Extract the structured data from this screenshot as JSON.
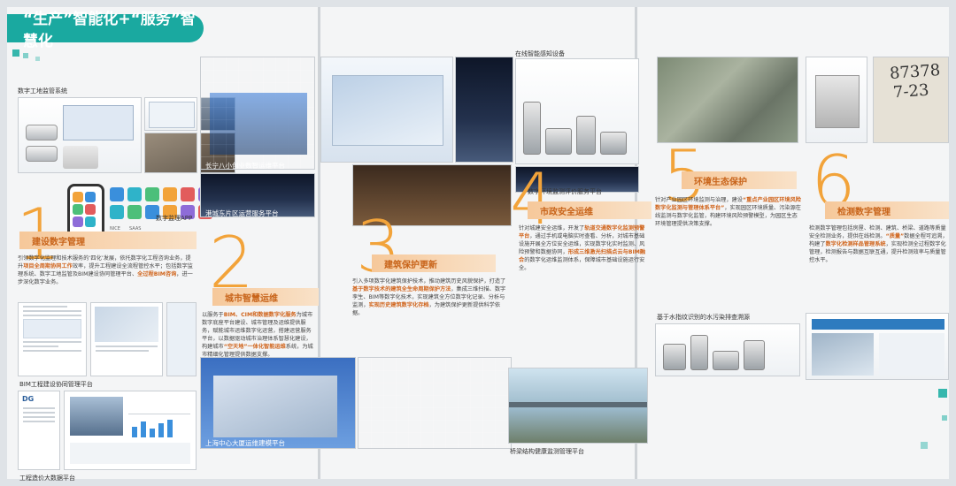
{
  "header": {
    "title": "“生产”智能化+“服务”智慧化"
  },
  "left_page": {
    "top_caption": "数字工地监管系统",
    "phone_caption": "数字监理APP",
    "bim_caption": "BIM工程建设协同管理平台",
    "bigdata_caption": "工程造价大数据平台",
    "section": {
      "number": "1",
      "title": "建设数字管理",
      "text_a": "引领数字化监理和技术服务的‘四化’发展，依托数字化工程咨询业务，提升",
      "hl_a": "项目全周期协同工作",
      "text_b": "效率，提升工程建设全流程管控水平；包括数字监理系统、数字工地监管及BIM建设协同管理平台、",
      "hl_b": "全过程BIM咨询",
      "text_c": "，进一步深化数字业务。"
    },
    "app_labels": {
      "a": "NICE",
      "b": "SAAS"
    }
  },
  "middle_page": {
    "shot_a_caption": "长宁八小创业数智运维平台",
    "shot_b_caption": "港城东片区运营服务平台",
    "shot_c_caption": "上海中心大厦运维建模平台",
    "section2": {
      "number": "2",
      "title": "城市智慧运维",
      "text_a": "以服务于",
      "hl_a": "BIM、CIM和数据数字化服务",
      "text_b": "为城市数字底座平台建设、城市管理及运维提供服务，赋能城市运维数字化运营，搭建运营服务平台，以数据驱动城市治理体系智慧化建设，构建城市",
      "hl_b": "“空天地”一体化智能运维",
      "text_c": "系统，为城市精细化管理提供数据支撑。"
    },
    "section3": {
      "number": "3",
      "title": "建筑保护更新",
      "text_a": "引入多项数字化建筑保护技术，推动建筑历史风貌保护，打造了",
      "hl_a": "基于数字技术的建筑全生命周期保护方法",
      "text_b": "，集成三维扫描、数字孪生、BIM等数字化技术，实现建筑全方位数字化记录、分析与监测，",
      "hl_b": "实现历史建筑数字化存档",
      "text_c": "，为建筑保护更新提供科学依据。"
    }
  },
  "right_page": {
    "equip_caption": "在线智能感知设备",
    "env_caption": "数字环境监测评价服务平台",
    "water_caption": "基于水指纹识别的水污染排查溯源",
    "bridge_caption": "桥梁结构健康监测管理平台",
    "section4": {
      "number": "4",
      "title": "市政安全运维",
      "text_a": "针对城建安全运维，开发了",
      "hl_a": "轨道交通数字化监测预警平台",
      "text_b": "，通过手机或电脑实时查看、分析，对城市基础设施开展全方位安全运维，实现数字化实时监测、风险预警和数据协同，",
      "hl_b": "形成三维激光扫描点云与BIM融合",
      "text_c": "的数字化运维监测体系，保障城市基础设施运行安全。"
    },
    "section5": {
      "number": "5",
      "title": "环境生态保护",
      "text_a": "针对产业园区环境监测与治理，建设",
      "hl_a": "“重点产业园区环境风险数字化监测与管理体系平台”",
      "text_b": "，实现园区环境质量、污染源在线监测与数字化监管，构建环境风险预警模型，为园区生态环境管理提供决策支撑。"
    },
    "section6": {
      "number": "6",
      "title": "检测数字管理",
      "text_a": "检测数字管理包括房屋、检测、建筑、桥梁、道路等质量安全检测业务，提供在线检测。",
      "hl_a": "“质量”",
      "text_b": "数据全程可追溯，构建了",
      "hl_b": "数字化检测样品管理系统",
      "text_c": "，实现检测全过程数字化管理，检测报告与数据互联互通，提升检测效率与质量管控水平。"
    },
    "sample_text": {
      "line1": "87378",
      "line2": "7-23"
    }
  },
  "colors": {
    "teal": "#1aa9a0",
    "orange": "#f2a33a",
    "orange_dark": "#c8641a",
    "band": "#f6c89a"
  }
}
